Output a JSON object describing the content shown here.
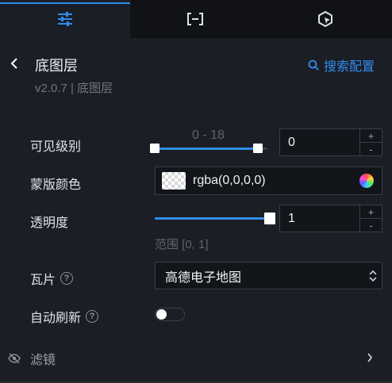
{
  "header": {
    "title": "底图层",
    "version": "v2.0.7 | 底图层",
    "search_link": "搜索配置"
  },
  "fields": {
    "visible_level": {
      "label": "可见级别",
      "range_hint": "0 - 18",
      "value": "0",
      "range_low": 0,
      "range_high": 18,
      "min": 0,
      "max": 18
    },
    "mask_color": {
      "label": "蒙版颜色",
      "value": "rgba(0,0,0,0)"
    },
    "opacity": {
      "label": "透明度",
      "value": "1",
      "fill_fraction": 1,
      "range_hint": "范围 [0, 1]"
    },
    "tile": {
      "label": "瓦片",
      "selected": "高德电子地图"
    },
    "auto_refresh": {
      "label": "自动刷新",
      "enabled": false
    },
    "filter": {
      "label": "滤镜"
    }
  },
  "stepper": {
    "plus": "+",
    "minus": "-"
  },
  "help_glyph": "?",
  "colors": {
    "accent": "#2f8cf0",
    "background": "#1b1e24",
    "tab_bar": "#101216"
  }
}
